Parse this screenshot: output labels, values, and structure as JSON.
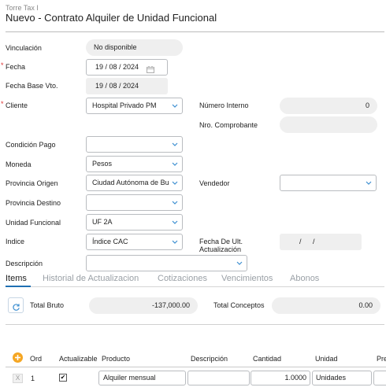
{
  "header": {
    "breadcrumb": "Torre Tax I",
    "title": "Nuevo - Contrato Alquiler de Unidad Funcional"
  },
  "form": {
    "vinculacion": {
      "label": "Vinculación",
      "value": "No disponible"
    },
    "fecha": {
      "label": "Fecha",
      "value": "19 / 08 / 2024"
    },
    "fecha_base": {
      "label": "Fecha Base Vto.",
      "value": "19 / 08 / 2024"
    },
    "cliente": {
      "label": "Cliente",
      "value": "Hospital Privado PM"
    },
    "numero_interno": {
      "label": "Número Interno",
      "value": "0"
    },
    "nro_comprobante": {
      "label": "Nro. Comprobante",
      "value": ""
    },
    "condicion_pago": {
      "label": "Condición Pago",
      "value": ""
    },
    "moneda": {
      "label": "Moneda",
      "value": "Pesos"
    },
    "provincia_origen": {
      "label": "Provincia Origen",
      "value": "Ciudad Autónoma de Bu"
    },
    "vendedor": {
      "label": "Vendedor",
      "value": ""
    },
    "provincia_destino": {
      "label": "Provincia Destino",
      "value": ""
    },
    "unidad_funcional": {
      "label": "Unidad Funcional",
      "value": "UF 2A"
    },
    "indice": {
      "label": "Indice",
      "value": "Índice CAC"
    },
    "fecha_ult_act": {
      "label_line1": "Fecha De Ult.",
      "label_line2": "Actualización",
      "value": "/ /"
    },
    "descripcion": {
      "label": "Descripción",
      "value": ""
    }
  },
  "tabs": [
    "Items",
    "Historial de Actualizacion",
    "Cotizaciones",
    "Vencimientos",
    "Abonos"
  ],
  "totals": {
    "bruto_label": "Total Bruto",
    "bruto_value": "-137,000.00",
    "conceptos_label": "Total Conceptos",
    "conceptos_value": "0.00"
  },
  "table": {
    "headers": [
      "Ord",
      "Actualizable",
      "Producto",
      "Descripción",
      "Cantidad",
      "Unidad",
      "Pre"
    ],
    "rows": [
      {
        "delete": "X",
        "ord": "1",
        "actualizable": "✔",
        "producto": "Alquiler mensual",
        "descripcion": "",
        "cantidad": "1.0000",
        "unidad": "Unidades"
      }
    ]
  },
  "colors": {
    "accent": "#f5a623",
    "tab_active_underline": "#1f6fb2",
    "refresh_icon": "#3d8fd1"
  },
  "icons": {
    "add": "plus-circle-icon",
    "refresh": "refresh-icon",
    "calendar": "calendar-icon",
    "chevron": "chevron-down-icon"
  }
}
